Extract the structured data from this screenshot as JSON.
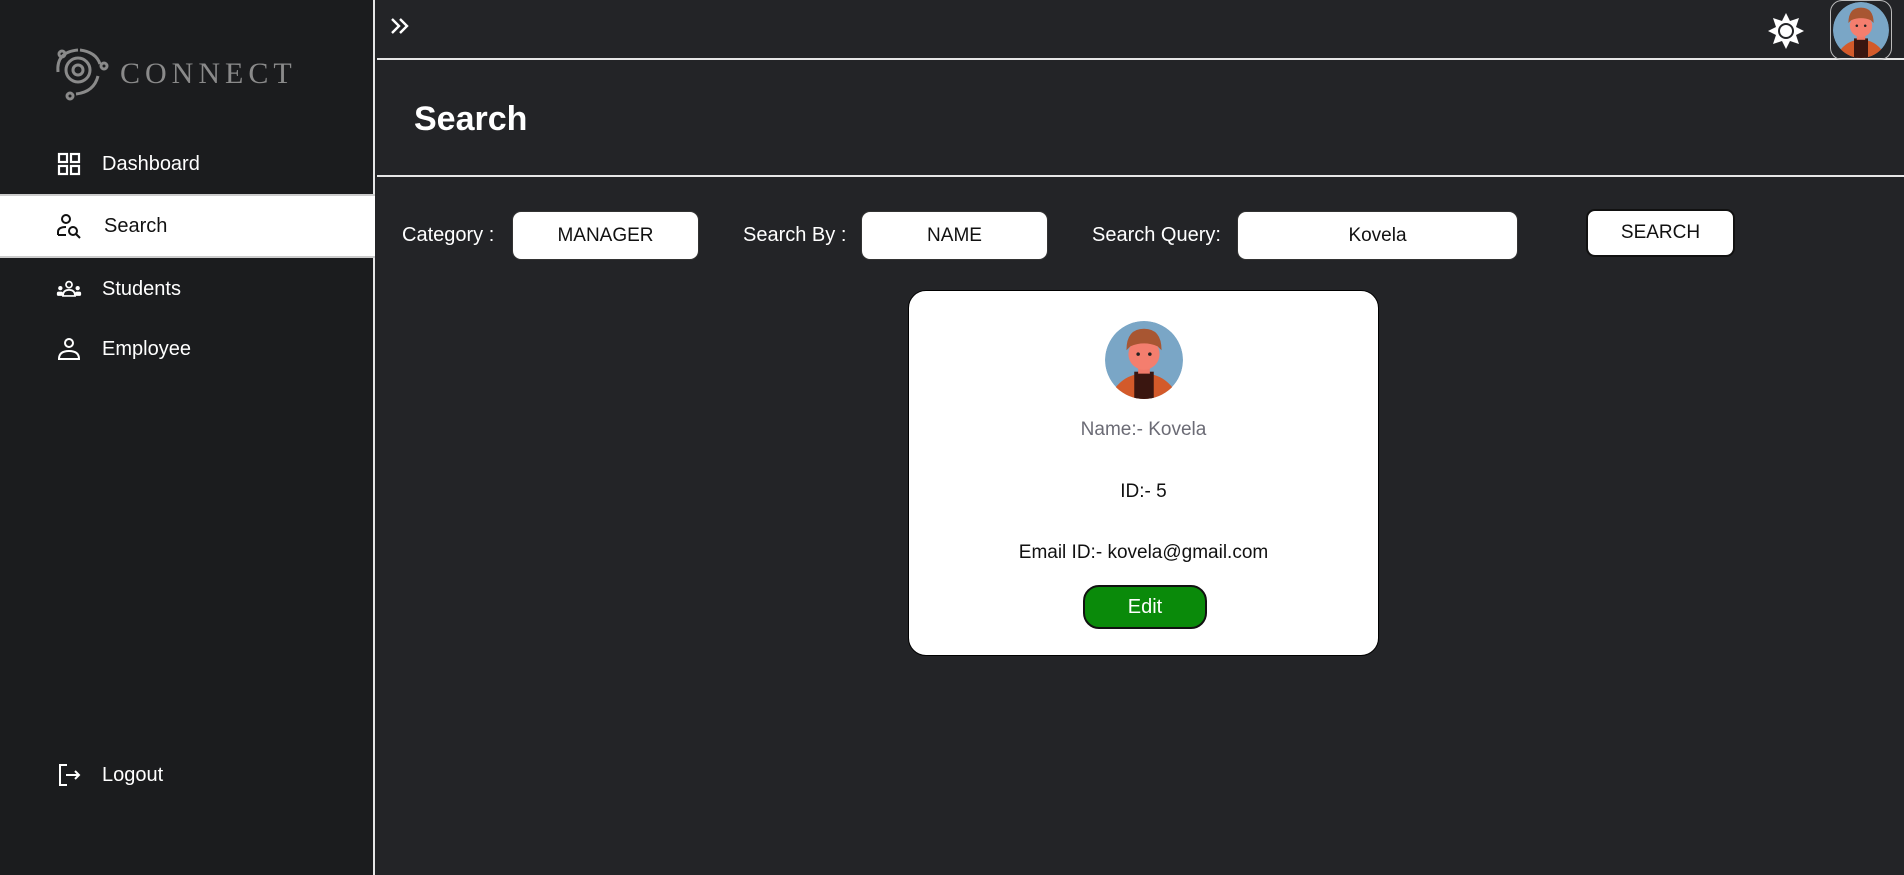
{
  "brand": {
    "name": "CONNECT"
  },
  "sidebar": {
    "items": [
      {
        "label": "Dashboard",
        "icon": "grid-icon"
      },
      {
        "label": "Search",
        "icon": "user-search-icon",
        "active": true
      },
      {
        "label": "Students",
        "icon": "users-icon"
      },
      {
        "label": "Employee",
        "icon": "user-icon"
      }
    ],
    "logout": {
      "label": "Logout",
      "icon": "logout-icon"
    }
  },
  "page": {
    "title": "Search"
  },
  "filters": {
    "category_label": "Category :",
    "category_value": "MANAGER",
    "search_by_label": "Search By :",
    "search_by_value": "NAME",
    "query_label": "Search Query:",
    "query_value": "Kovela",
    "search_button": "SEARCH"
  },
  "result": {
    "name": "Name:- Kovela",
    "id": "ID:- 5",
    "email": "Email ID:- kovela@gmail.com",
    "edit_label": "Edit"
  },
  "colors": {
    "sidebar": "#1b1c1e",
    "main": "#232427",
    "edit": "#0a8a0a"
  }
}
